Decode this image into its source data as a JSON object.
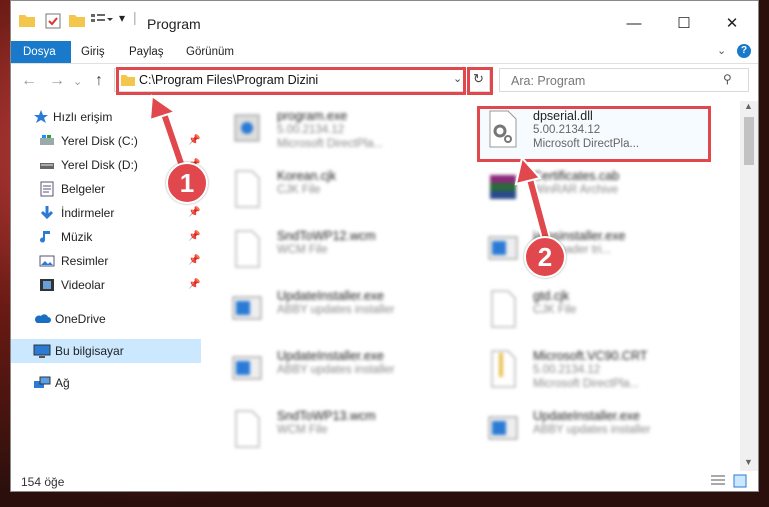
{
  "window": {
    "title": "Program",
    "minimize": "—",
    "maximize": "☐",
    "close": "✕"
  },
  "ribbon": {
    "tabs": [
      "Dosya",
      "Giriş",
      "Paylaş",
      "Görünüm"
    ]
  },
  "navigation": {
    "address": "C:\\Program Files\\Program Dizini",
    "search_placeholder": "Ara: Program"
  },
  "sidebar": {
    "items": [
      {
        "label": "Hızlı erişim"
      },
      {
        "label": "Yerel Disk (C:)"
      },
      {
        "label": "Yerel Disk (D:)"
      },
      {
        "label": "Belgeler"
      },
      {
        "label": "İndirmeler"
      },
      {
        "label": "Müzik"
      },
      {
        "label": "Resimler"
      },
      {
        "label": "Videolar"
      },
      {
        "label": "OneDrive"
      },
      {
        "label": "Bu bilgisayar"
      },
      {
        "label": "Ağ"
      }
    ]
  },
  "files": [
    {
      "name": "program.exe",
      "line2": "5.00.2134.12",
      "line3": "Microsoft DirectPla..."
    },
    {
      "name": "dpserial.dll",
      "line2": "5.00.2134.12",
      "line3": "Microsoft DirectPla..."
    },
    {
      "name": "Korean.cjk",
      "line2": "CJK File",
      "line3": ""
    },
    {
      "name": "Certificates.cab",
      "line2": "WinRAR Archive",
      "line3": ""
    },
    {
      "name": "SndToWP12.wcm",
      "line2": "WCM File",
      "line3": ""
    },
    {
      "name": "jamsinstaller.exe",
      "line2": "Finereader tri...",
      "line3": ""
    },
    {
      "name": "UpdateInstaller.exe",
      "line2": "ABBY updates installer",
      "line3": ""
    },
    {
      "name": "gtd.cjk",
      "line2": "CJK File",
      "line3": ""
    },
    {
      "name": "UpdateInstaller.exe",
      "line2": "ABBY updates installer",
      "line3": ""
    },
    {
      "name": "Microsoft.VC90.CRT",
      "line2": "5.00.2134.12",
      "line3": "Microsoft DirectPla..."
    },
    {
      "name": "SndToWP13.wcm",
      "line2": "WCM File",
      "line3": ""
    },
    {
      "name": "UpdateInstaller.exe",
      "line2": "ABBY updates installer",
      "line3": ""
    }
  ],
  "annotations": {
    "badge1": "1",
    "badge2": "2"
  },
  "status": {
    "count": "154 öğe"
  },
  "colors": {
    "accent": "#1979ca",
    "highlight": "#e0484d",
    "selected": "#cce8ff"
  }
}
